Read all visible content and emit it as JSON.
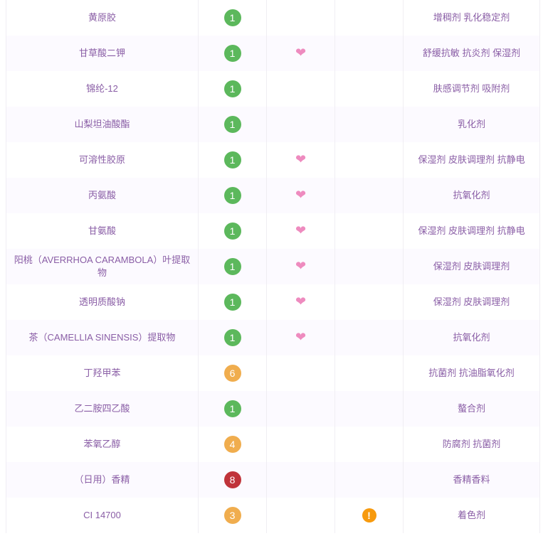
{
  "colors": {
    "low": "#5cb85c",
    "mid": "#f0ad4e",
    "high": "#c0343a",
    "text": "#8a5ea6",
    "heart": "#ee8bbf",
    "warn": "#f79a0e"
  },
  "rows": [
    {
      "name": "黄原胶",
      "score": "1",
      "level": "low",
      "active": false,
      "acne": false,
      "purpose": "增稠剂 乳化稳定剂"
    },
    {
      "name": "甘草酸二钾",
      "score": "1",
      "level": "low",
      "active": true,
      "acne": false,
      "purpose": "舒缓抗敏 抗炎剂 保湿剂"
    },
    {
      "name": "锦纶-12",
      "score": "1",
      "level": "low",
      "active": false,
      "acne": false,
      "purpose": "肤感调节剂 吸附剂"
    },
    {
      "name": "山梨坦油酸酯",
      "score": "1",
      "level": "low",
      "active": false,
      "acne": false,
      "purpose": "乳化剂"
    },
    {
      "name": "可溶性胶原",
      "score": "1",
      "level": "low",
      "active": true,
      "acne": false,
      "purpose": "保湿剂 皮肤调理剂 抗静电"
    },
    {
      "name": "丙氨酸",
      "score": "1",
      "level": "low",
      "active": true,
      "acne": false,
      "purpose": "抗氧化剂"
    },
    {
      "name": "甘氨酸",
      "score": "1",
      "level": "low",
      "active": true,
      "acne": false,
      "purpose": "保湿剂 皮肤调理剂 抗静电"
    },
    {
      "name": "阳桃（AVERRHOA CARAMBOLA）叶提取物",
      "score": "1",
      "level": "low",
      "active": true,
      "acne": false,
      "purpose": "保湿剂 皮肤调理剂"
    },
    {
      "name": "透明质酸钠",
      "score": "1",
      "level": "low",
      "active": true,
      "acne": false,
      "purpose": "保湿剂 皮肤调理剂"
    },
    {
      "name": "茶（CAMELLIA SINENSIS）提取物",
      "score": "1",
      "level": "low",
      "active": true,
      "acne": false,
      "purpose": "抗氧化剂"
    },
    {
      "name": "丁羟甲苯",
      "score": "6",
      "level": "mid",
      "active": false,
      "acne": false,
      "purpose": "抗菌剂 抗油脂氧化剂"
    },
    {
      "name": "乙二胺四乙酸",
      "score": "1",
      "level": "low",
      "active": false,
      "acne": false,
      "purpose": "螯合剂"
    },
    {
      "name": "苯氧乙醇",
      "score": "4",
      "level": "mid",
      "active": false,
      "acne": false,
      "purpose": "防腐剂 抗菌剂"
    },
    {
      "name": "（日用）香精",
      "score": "8",
      "level": "high",
      "active": false,
      "acne": false,
      "purpose": "香精香料"
    },
    {
      "name": "CI 14700",
      "score": "3",
      "level": "mid",
      "active": false,
      "acne": true,
      "purpose": "着色剂"
    }
  ]
}
